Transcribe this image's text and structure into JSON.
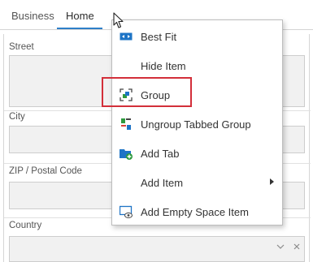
{
  "tabs": [
    {
      "label": "Business"
    },
    {
      "label": "Home",
      "active": true
    }
  ],
  "form": {
    "fields": [
      {
        "label": "Street",
        "value": ""
      },
      {
        "label": "City",
        "value": ""
      },
      {
        "label": "ZIP / Postal Code",
        "value": ""
      },
      {
        "label": "Country",
        "value": ""
      }
    ]
  },
  "context_menu": {
    "items": [
      {
        "label": "Best Fit",
        "icon": "best-fit-icon"
      },
      {
        "label": "Hide Item",
        "icon": ""
      },
      {
        "label": "Group",
        "icon": "group-icon",
        "highlighted": true
      },
      {
        "label": "Ungroup Tabbed Group",
        "icon": "ungroup-icon"
      },
      {
        "label": "Add Tab",
        "icon": "add-tab-icon"
      },
      {
        "label": "Add Item",
        "icon": "",
        "has_submenu": true
      },
      {
        "label": "Add Empty Space Item",
        "icon": "empty-space-icon"
      }
    ]
  },
  "colors": {
    "accent": "#2e7fc8",
    "highlight": "#d32f3a",
    "icon_blue": "#1e74c6",
    "icon_green": "#2e9a3e",
    "icon_red": "#d9423a"
  }
}
